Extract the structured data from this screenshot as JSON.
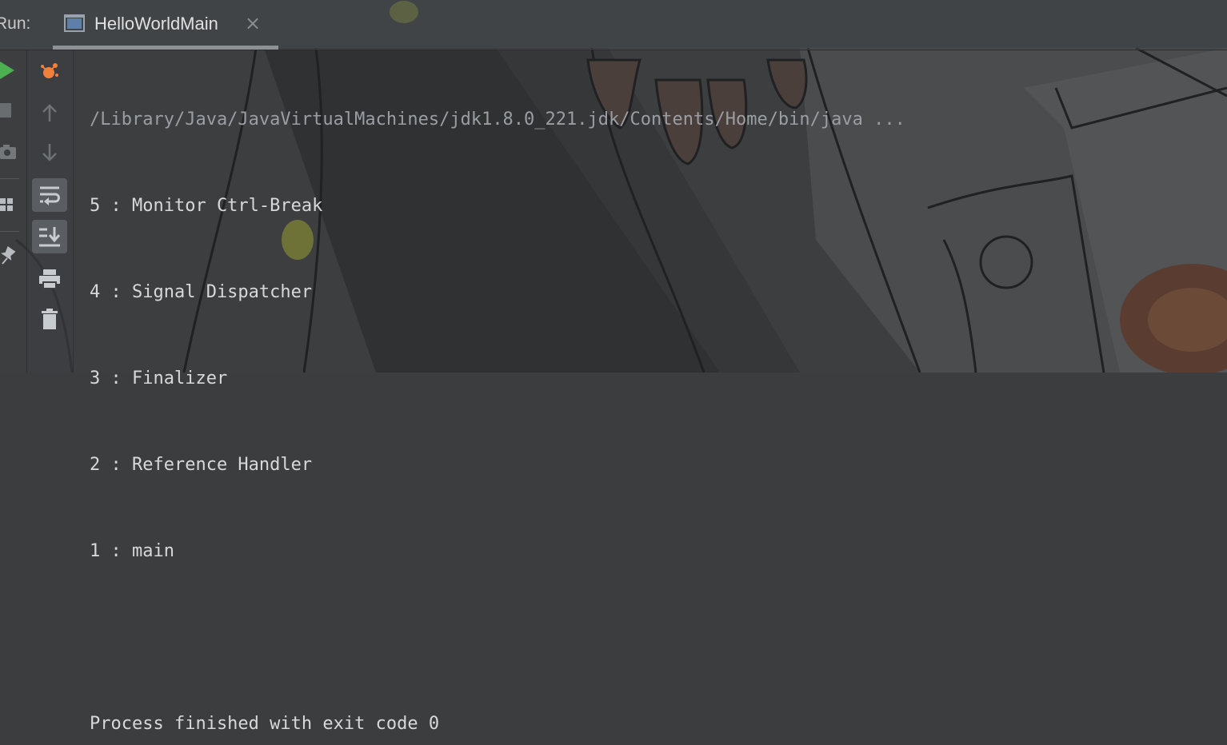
{
  "header": {
    "run_label": "Run:",
    "tab_title": "HelloWorldMain",
    "tab_close": "×"
  },
  "toolbar_outer": {
    "icons": [
      "run-icon",
      "stop-icon",
      "camera-icon",
      "layout-icon",
      "pin-icon"
    ]
  },
  "toolbar_inner": {
    "icons": [
      "debug-bug-icon",
      "arrow-up-icon",
      "arrow-down-icon",
      "soft-wrap-icon",
      "scroll-to-end-icon",
      "print-icon",
      "trash-icon"
    ]
  },
  "console": {
    "command": "/Library/Java/JavaVirtualMachines/jdk1.8.0_221.jdk/Contents/Home/bin/java ...",
    "lines": [
      "5 : Monitor Ctrl-Break",
      "4 : Signal Dispatcher",
      "3 : Finalizer",
      "2 : Reference Handler",
      "1 : main"
    ],
    "blank": "",
    "exit_message": "Process finished with exit code 0"
  },
  "colors": {
    "background": "#3b3d3f",
    "text": "#d8d8d8",
    "command_text": "#9a9ea3",
    "run_green": "#4caf50",
    "debug_orange": "#f0803c"
  }
}
